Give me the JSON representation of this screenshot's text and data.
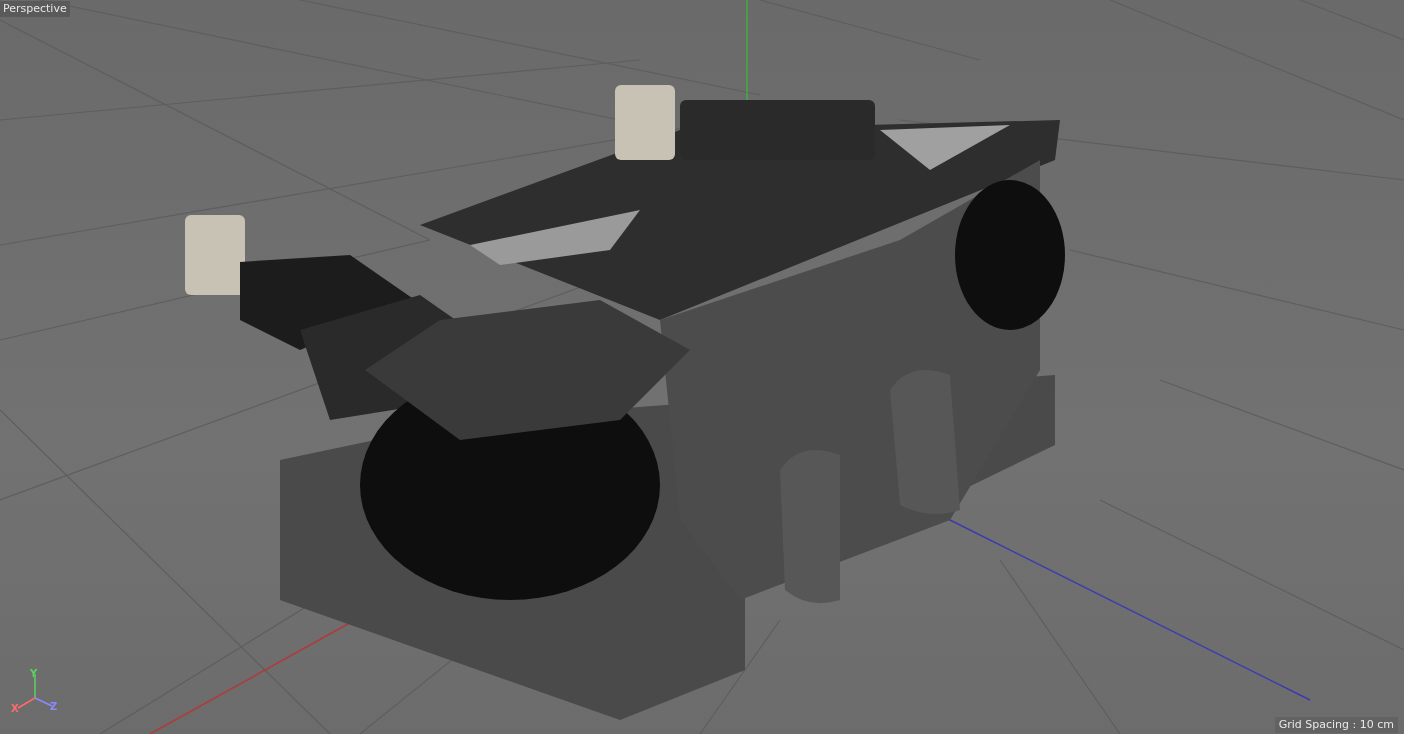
{
  "viewport": {
    "view_label": "Perspective",
    "grid_spacing": "Grid Spacing : 10 cm"
  },
  "axis_gizmo": [
    {
      "kind": "y",
      "label": "Y"
    },
    {
      "kind": "x",
      "label": "X"
    },
    {
      "kind": "z",
      "label": "Z"
    }
  ]
}
